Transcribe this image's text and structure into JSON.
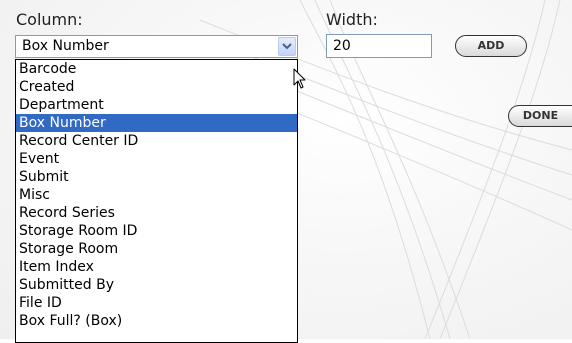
{
  "form": {
    "column_label": "Column:",
    "width_label": "Width:",
    "column_selected": "Box Number",
    "width_value": "20",
    "add_label": "ADD",
    "done_label": "DONE"
  },
  "dropdown": {
    "options": [
      "Barcode",
      "Created",
      "Department",
      "Box Number",
      "Record Center ID",
      "Event",
      "Submit",
      "Misc",
      "Record Series",
      "Storage Room ID",
      "Storage Room",
      "Item Index",
      "Submitted By",
      "File ID",
      "Box Full? (Box)"
    ],
    "highlighted": "Box Number"
  },
  "colors": {
    "highlight": "#316ac5",
    "input_border": "#7f9db9"
  },
  "icons": {
    "dropdown_arrow": "chevron-down-icon",
    "cursor": "mouse-pointer-icon"
  }
}
